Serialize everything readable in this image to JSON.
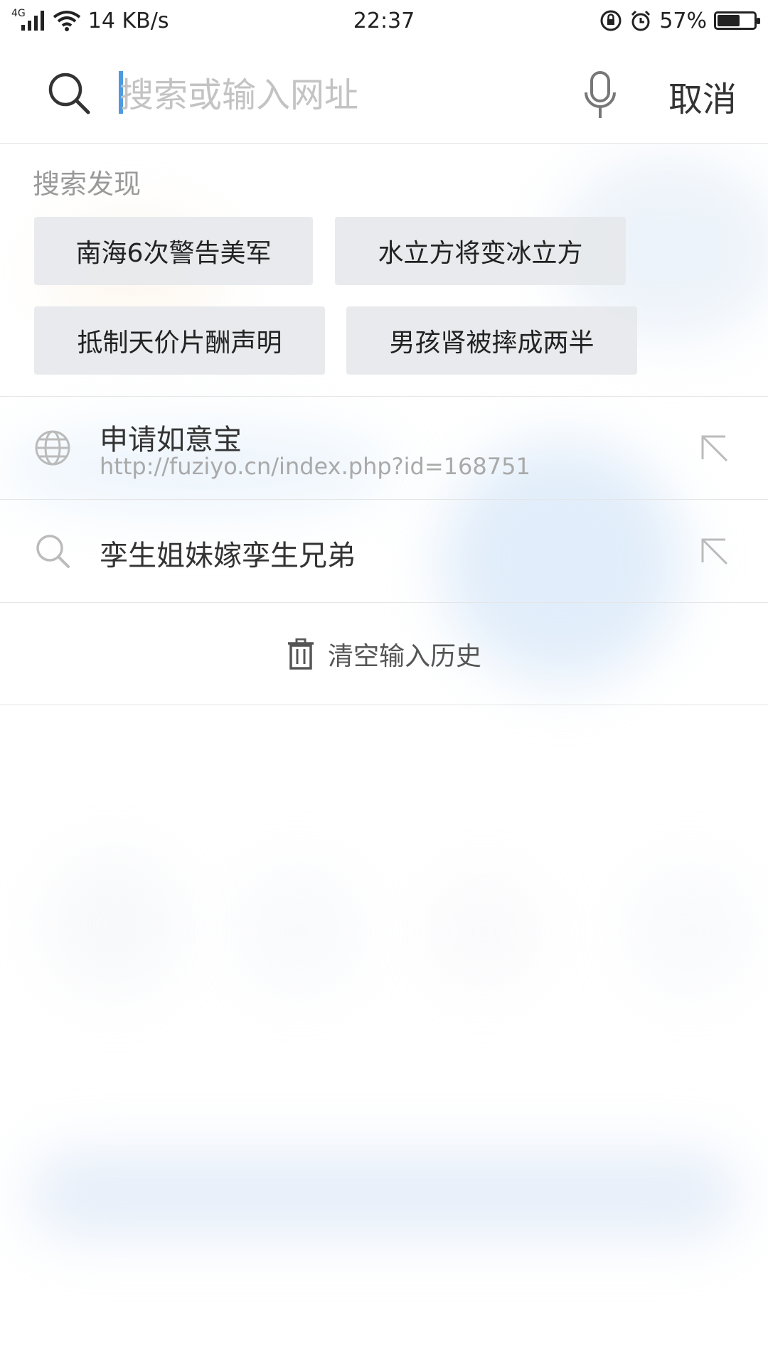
{
  "status_bar": {
    "network_type": "4G",
    "net_speed": "14 KB/s",
    "time": "22:37",
    "battery_percent": "57%",
    "battery_level": 0.57,
    "icons": [
      "signal-icon",
      "wifi-icon",
      "rotation-lock-icon",
      "alarm-icon",
      "battery-icon"
    ]
  },
  "search": {
    "placeholder": "搜索或输入网址",
    "value": "",
    "cancel_label": "取消",
    "icons": [
      "search-icon",
      "microphone-icon"
    ]
  },
  "discover": {
    "title": "搜索发现",
    "chips": [
      "南海6次警告美军",
      "水立方将变冰立方",
      "抵制天价片酬声明",
      "男孩肾被摔成两半"
    ]
  },
  "history": [
    {
      "title": "申请如意宝",
      "url": "http://fuziyo.cn/index.php?id=168751",
      "icon": "globe-icon"
    },
    {
      "title": "孪生姐妹嫁孪生兄弟",
      "icon": "search-icon"
    }
  ],
  "clear_history": {
    "label": "清空输入历史",
    "icon": "trash-icon"
  },
  "colors": {
    "accent": "#4d9ae0",
    "chip_bg": "#e6e8ec",
    "muted_text": "#9a9a9a"
  }
}
